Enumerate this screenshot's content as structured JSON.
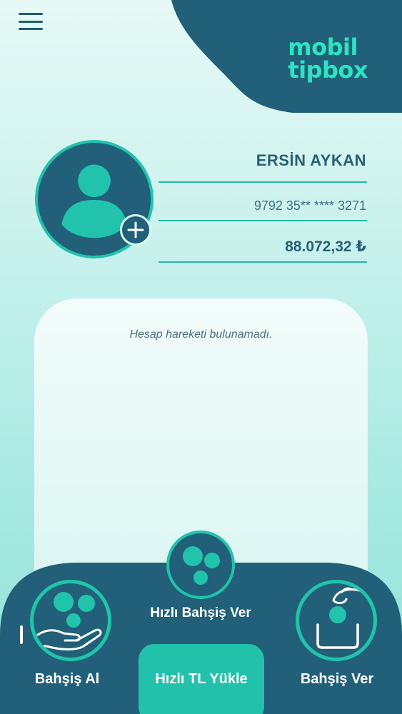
{
  "app": {
    "logo_line1": "mobil",
    "logo_line2": "tipbo",
    "logo_x": "x",
    "brand_color": "#216078",
    "accent_color": "#21c3ac"
  },
  "header": {
    "menu_icon": "hamburger-icon"
  },
  "profile": {
    "name": "ERSİN AYKAN",
    "card_number": "9792 35** **** 3271",
    "balance": "88.072,32 ₺",
    "avatar_icon": "user-avatar-icon",
    "add_photo_icon": "plus-icon"
  },
  "transactions": {
    "empty_message": "Hesap hareketi bulunamadı."
  },
  "bottom_nav": {
    "quick_tip_label": "Hızlı Bahşiş Ver",
    "receive_tip_label": "Bahşiş Al",
    "quick_load_label": "Hızlı TL Yükle",
    "give_tip_label": "Bahşiş Ver",
    "quick_tip_icon": "coins-icon",
    "receive_tip_icon": "hand-coins-icon",
    "give_tip_icon": "hand-drop-coin-icon"
  }
}
